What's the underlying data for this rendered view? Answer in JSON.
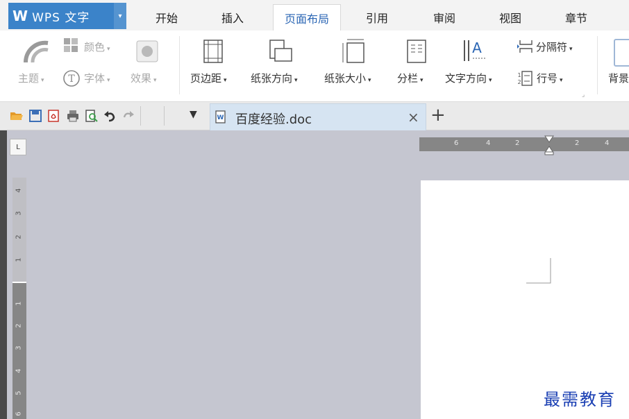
{
  "app": {
    "logo": "W",
    "name": "WPS 文字",
    "dropdown_arrow": "▾"
  },
  "tabs": [
    {
      "label": "开始"
    },
    {
      "label": "插入"
    },
    {
      "label": "页面布局",
      "active": true
    },
    {
      "label": "引用"
    },
    {
      "label": "审阅"
    },
    {
      "label": "视图"
    },
    {
      "label": "章节"
    }
  ],
  "ribbon": {
    "theme": "主题",
    "color": "颜色",
    "font": "字体",
    "effect": "效果",
    "margins": "页边距",
    "orientation": "纸张方向",
    "size": "纸张大小",
    "columns": "分栏",
    "text_direction": "文字方向",
    "line_number": "行号",
    "breaks": "分隔符",
    "background": "背景"
  },
  "document_tab": {
    "filename": "百度经验.doc",
    "close": "×",
    "new": "+"
  },
  "hruler_numbers": [
    "6",
    "4",
    "2",
    "2",
    "4"
  ],
  "vruler_numbers": [
    "4",
    "3",
    "2",
    "1",
    "1",
    "2",
    "3",
    "4",
    "5",
    "6"
  ],
  "watermark": "最需教育",
  "colors": {
    "accent": "#3b83c9",
    "active_tab_text": "#2b66b4",
    "watermark": "#1a3fb3"
  }
}
